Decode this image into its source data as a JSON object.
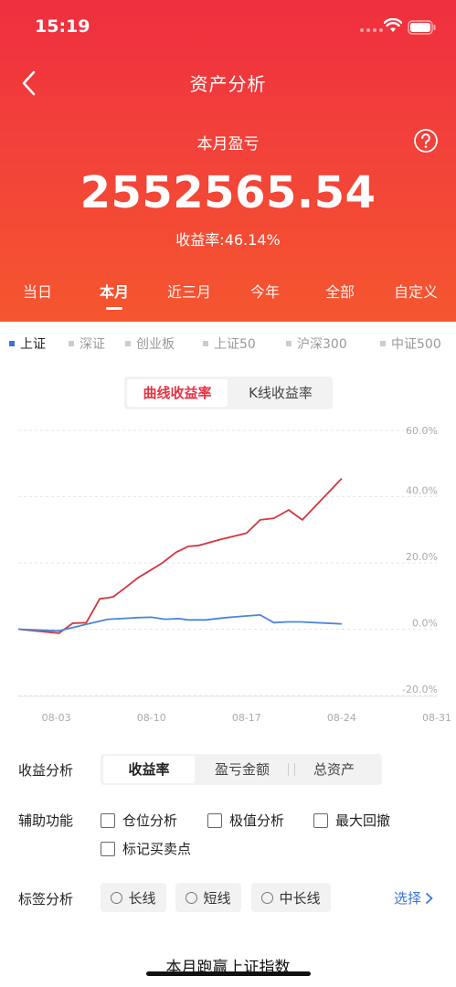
{
  "status_bar": {
    "time": "15:19"
  },
  "nav": {
    "title": "资产分析"
  },
  "summary": {
    "label": "本月盈亏",
    "value": "2552565.54",
    "return_rate": "收益率:46.14%"
  },
  "period_tabs": [
    {
      "label": "当日",
      "active": false
    },
    {
      "label": "本月",
      "active": true
    },
    {
      "label": "近三月",
      "active": false
    },
    {
      "label": "今年",
      "active": false
    },
    {
      "label": "全部",
      "active": false
    },
    {
      "label": "自定义",
      "active": false
    }
  ],
  "indices": [
    {
      "label": "上证",
      "active": true
    },
    {
      "label": "深证",
      "active": false
    },
    {
      "label": "创业板",
      "active": false
    },
    {
      "label": "上证50",
      "active": false
    },
    {
      "label": "沪深300",
      "active": false
    },
    {
      "label": "中证500",
      "active": false
    }
  ],
  "chart_toggle": {
    "curve": "曲线收益率",
    "kline": "K线收益率"
  },
  "chart_data": {
    "type": "line",
    "ylim": [
      -20,
      60
    ],
    "y_ticks": [
      "60.0%",
      "40.0%",
      "20.0%",
      "0.0%",
      "-20.0%"
    ],
    "y_tick_values": [
      60,
      40,
      20,
      0,
      -20
    ],
    "x_ticks": [
      "08-03",
      "08-10",
      "08-17",
      "08-24",
      "08-31"
    ],
    "x_tick_days": [
      3,
      10,
      17,
      24,
      31
    ],
    "xlim": [
      0.2,
      31
    ],
    "series": [
      {
        "color": "#d2363b",
        "x": [
          0.2,
          3.2,
          4.2,
          5.2,
          6.2,
          6.8,
          7.2,
          8.1,
          9.0,
          10.0,
          10.8,
          11.8,
          12.7,
          13.5,
          15.0,
          17.0,
          18.0,
          19.0,
          20.1,
          21.1,
          24.0
        ],
        "y": [
          0,
          -1.2,
          1.8,
          2.0,
          9.2,
          9.5,
          9.8,
          12.6,
          15.5,
          18.0,
          20.0,
          23.2,
          25.0,
          25.3,
          27.0,
          29.0,
          33.0,
          33.5,
          36.0,
          33.0,
          45.5
        ]
      },
      {
        "color": "#4a86d8",
        "x": [
          0.2,
          3.2,
          4.2,
          5.2,
          6.8,
          7.8,
          9.0,
          10.0,
          11.0,
          12.0,
          12.7,
          14.0,
          15.5,
          17.0,
          18.0,
          19.0,
          20.0,
          21.0,
          24.0
        ],
        "y": [
          0,
          -0.5,
          0.5,
          1.5,
          3.0,
          3.2,
          3.5,
          3.6,
          3.0,
          3.2,
          2.8,
          2.8,
          3.5,
          4.0,
          4.3,
          2.0,
          2.2,
          2.2,
          1.6
        ]
      }
    ]
  },
  "metric_analysis": {
    "label": "收益分析",
    "options": [
      {
        "label": "收益率",
        "active": true
      },
      {
        "label": "盈亏金额",
        "active": false
      },
      {
        "label": "总资产",
        "active": false
      }
    ]
  },
  "aux": {
    "label": "辅助功能",
    "options": [
      "仓位分析",
      "极值分析",
      "最大回撤",
      "标记买卖点"
    ]
  },
  "tags": {
    "label": "标签分析",
    "options": [
      "长线",
      "短线",
      "中长线"
    ],
    "select": "选择"
  },
  "bottom_heading": "本月跑赢上证指数",
  "colors": {
    "brand_red": "#ef2f3f",
    "brand_orange": "#f5562f",
    "index_blue": "#3b74d8",
    "link_blue": "#3a74d8"
  }
}
